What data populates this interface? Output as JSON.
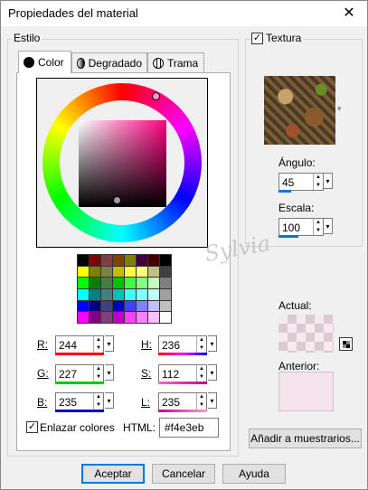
{
  "window": {
    "title": "Propiedades del material"
  },
  "estilo": {
    "legend": "Estilo",
    "tabs": [
      {
        "label": "Color",
        "icon": "solid-circle-icon"
      },
      {
        "label": "Degradado",
        "icon": "gradient-circle-icon"
      },
      {
        "label": "Trama",
        "icon": "pattern-globe-icon"
      }
    ],
    "selected_color": "#f4e3eb"
  },
  "rgb": {
    "r": {
      "label": "R:",
      "value": "244"
    },
    "g": {
      "label": "G:",
      "value": "227"
    },
    "b": {
      "label": "B:",
      "value": "235"
    }
  },
  "hsl": {
    "h": {
      "label": "H:",
      "value": "236"
    },
    "s": {
      "label": "S:",
      "value": "112"
    },
    "l": {
      "label": "L:",
      "value": "235"
    }
  },
  "link_colors": {
    "label": "Enlazar colores",
    "checked": true
  },
  "html": {
    "label": "HTML:",
    "value": "#f4e3eb"
  },
  "textura": {
    "label": "Textura",
    "checked": true,
    "angulo": {
      "label": "Ángulo:",
      "value": "45"
    },
    "escala": {
      "label": "Escala:",
      "value": "100"
    }
  },
  "watermark": "Sylvia",
  "actual": {
    "label": "Actual:"
  },
  "anterior": {
    "label": "Anterior:"
  },
  "swatch_button": "Añadir a muestrarios...",
  "buttons": {
    "ok": "Aceptar",
    "cancel": "Cancelar",
    "help": "Ayuda"
  },
  "palette_colors": [
    "#000000",
    "#800000",
    "#804040",
    "#804000",
    "#808000",
    "#400040",
    "#400000",
    "#000000",
    "#ffff00",
    "#808000",
    "#808040",
    "#c0c000",
    "#ffff40",
    "#ffff80",
    "#c0c080",
    "#404040",
    "#00ff00",
    "#008000",
    "#408040",
    "#00c000",
    "#40ff40",
    "#80ff80",
    "#c0ffc0",
    "#808080",
    "#00ffff",
    "#008080",
    "#408080",
    "#00c0c0",
    "#40ffff",
    "#80ffff",
    "#c0ffff",
    "#a0a0a0",
    "#0000ff",
    "#000080",
    "#404080",
    "#0000c0",
    "#4040ff",
    "#8080ff",
    "#c0c0ff",
    "#c0c0c0",
    "#ff00ff",
    "#800080",
    "#804080",
    "#c000c0",
    "#ff40ff",
    "#ff80ff",
    "#ffc0ff",
    "#ffffff"
  ]
}
